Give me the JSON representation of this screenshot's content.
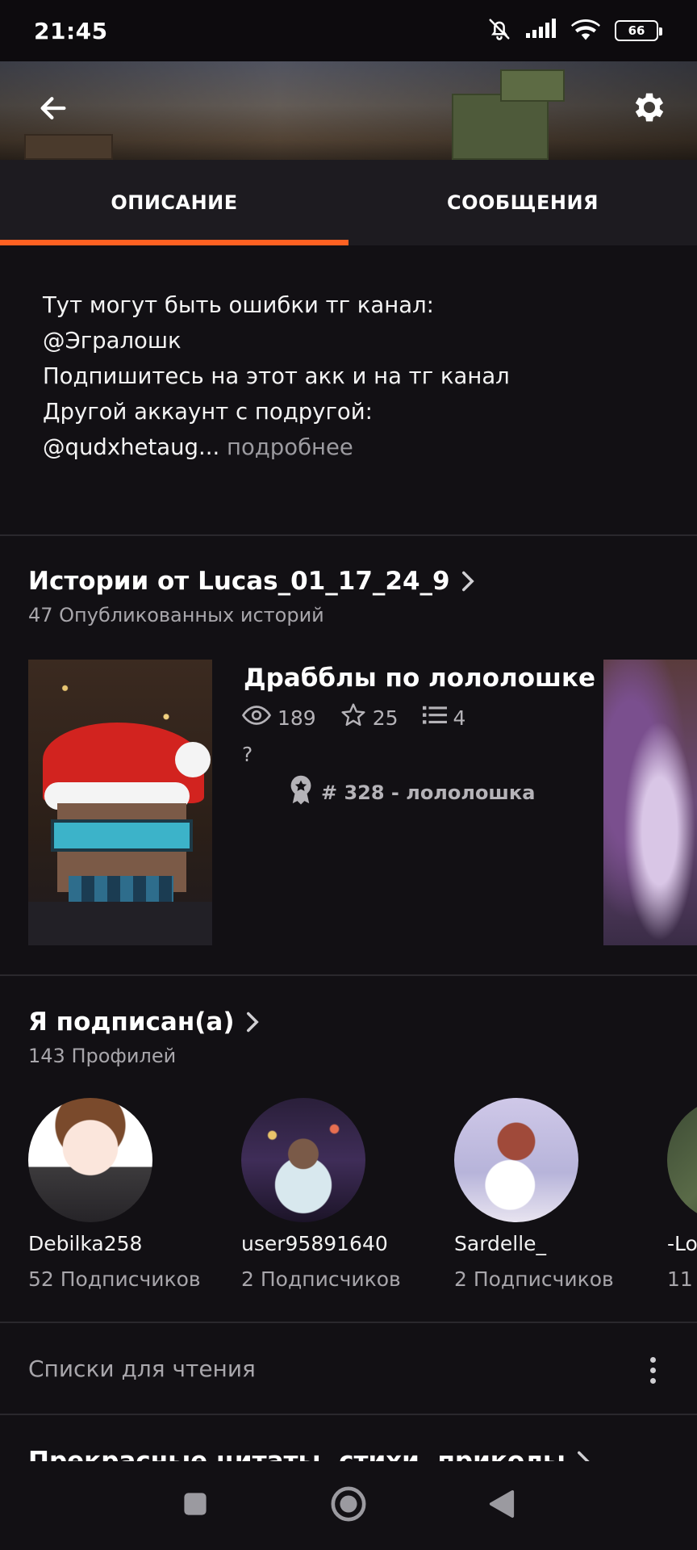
{
  "status_bar": {
    "time": "21:45",
    "battery": "66",
    "icons": [
      "bell-muted-icon",
      "signal-icon",
      "wifi-icon",
      "battery-icon"
    ]
  },
  "header": {
    "back_icon": "arrow-left-icon",
    "settings_icon": "gear-icon"
  },
  "tabs": [
    {
      "label": "ОПИСАНИЕ",
      "active": true
    },
    {
      "label": "СООБЩЕНИЯ",
      "active": false
    }
  ],
  "accent_color": "#ff6122",
  "description": {
    "lines": [
      "Тут могут быть ошибки тг канал:",
      "@Эгралошк",
      "Подпишитесь на этот акк и на тг канал",
      "Другой аккаунт с подругой:",
      "@qudxhetaug..."
    ],
    "more": "подробнее"
  },
  "stories": {
    "title": "Истории от Lucas_01_17_24_9",
    "subtitle": "47 Опубликованных историй",
    "featured": {
      "title": "Драбблы по лололошке",
      "views": "189",
      "votes": "25",
      "parts": "4",
      "blurb": "?",
      "rank": "# 328 - лололошка"
    }
  },
  "following": {
    "title": "Я подписан(а)",
    "subtitle": "143 Профилей",
    "profiles": [
      {
        "name": "Debilka258",
        "followers": "52 Подписчиков"
      },
      {
        "name": "user95891640",
        "followers": "2 Подписчиков"
      },
      {
        "name": "Sardelle_",
        "followers": "2 Подписчиков"
      },
      {
        "name": "-Lo",
        "followers": "11"
      }
    ]
  },
  "reading_lists": {
    "label": "Списки для чтения",
    "first_list_title": "Прекрасные цитаты, стихи, приколы"
  },
  "nav_bar": {
    "icons": [
      "square-recents-icon",
      "circle-home-icon",
      "triangle-back-icon"
    ]
  }
}
